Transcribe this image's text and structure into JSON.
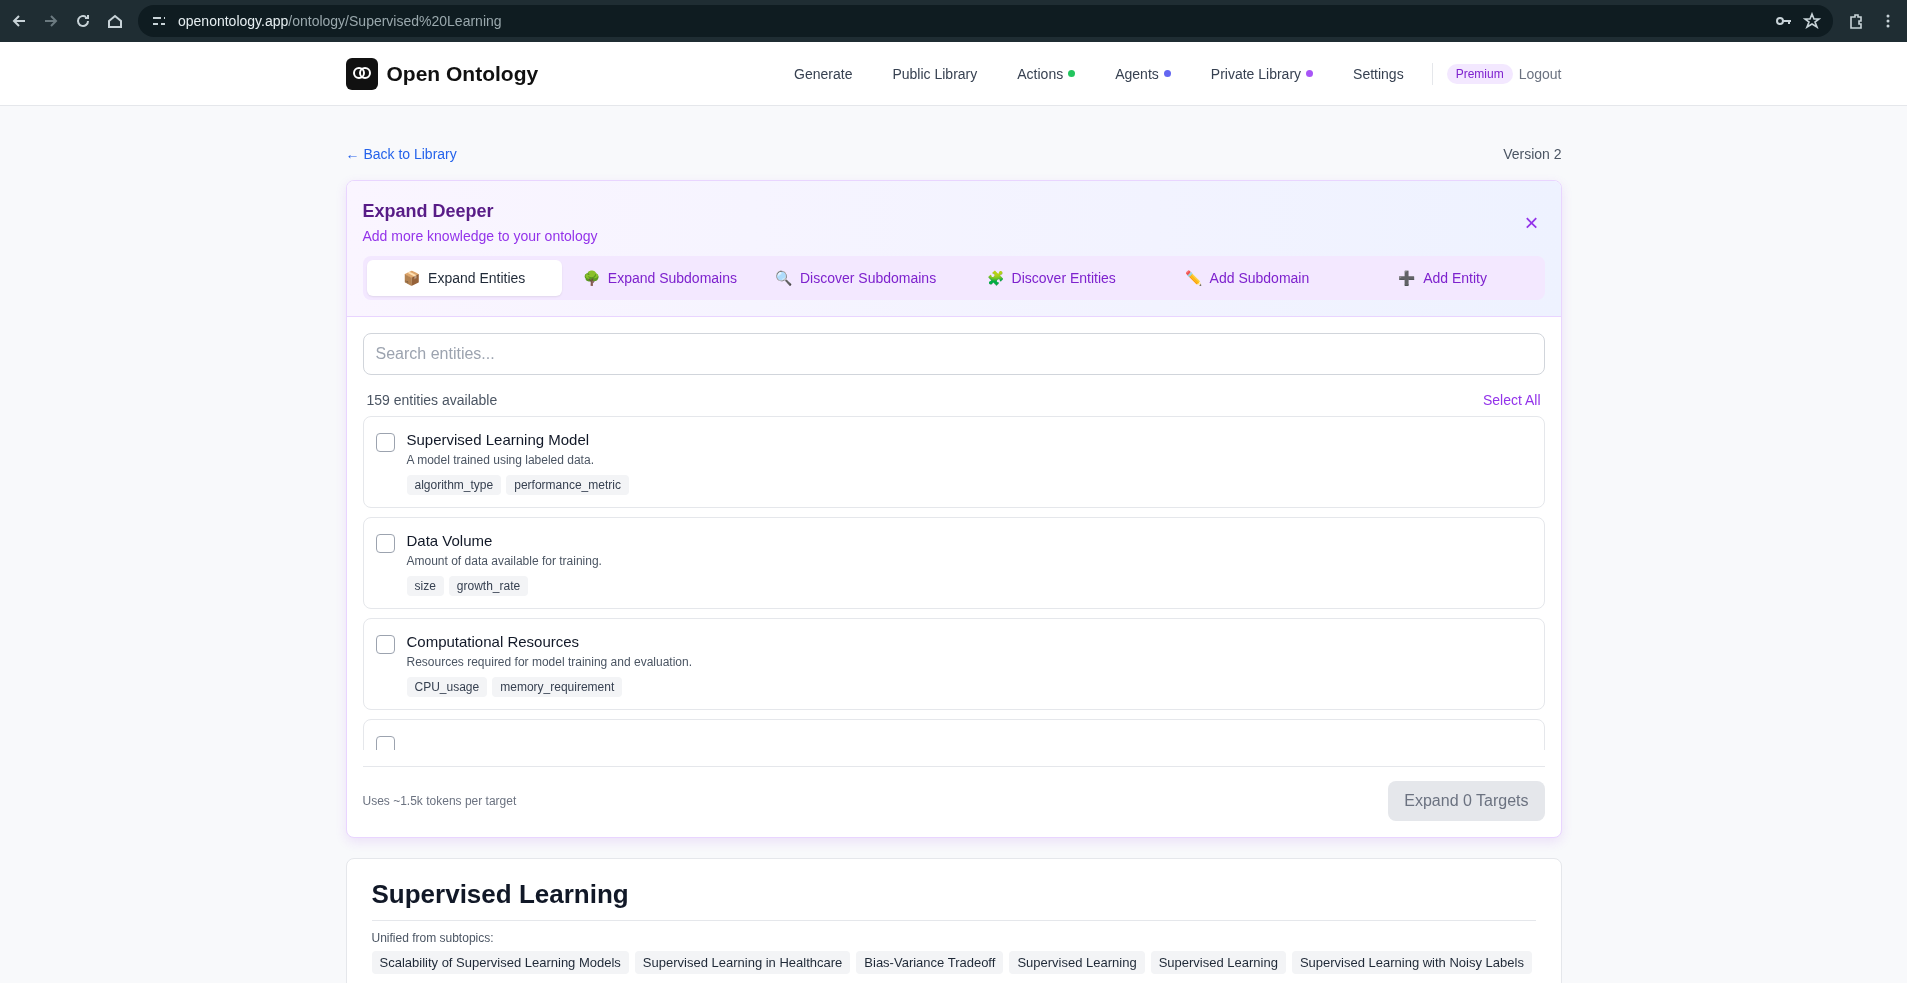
{
  "browser": {
    "url_host": "openontology.app",
    "url_path": "/ontology/Supervised%20Learning"
  },
  "header": {
    "brand": "Open Ontology",
    "nav": [
      {
        "label": "Generate"
      },
      {
        "label": "Public Library"
      },
      {
        "label": "Actions",
        "color": "#22c55e"
      },
      {
        "label": "Agents",
        "color": "#6366f1"
      },
      {
        "label": "Private Library",
        "color": "#a855f7"
      },
      {
        "label": "Settings"
      }
    ],
    "badge": "Premium",
    "logout": "Logout"
  },
  "back_link": "← Back to Library",
  "version": "Version 2",
  "expand_panel": {
    "title": "Expand Deeper",
    "subtitle": "Add more knowledge to your ontology",
    "close": "×",
    "tabs": [
      {
        "icon": "📦",
        "label": "Expand Entities",
        "selected": true
      },
      {
        "icon": "🌳",
        "label": "Expand Subdomains",
        "selected": false
      },
      {
        "icon": "🔍",
        "label": "Discover Subdomains",
        "selected": false
      },
      {
        "icon": "🧩",
        "label": "Discover Entities",
        "selected": false
      },
      {
        "icon": "✏️",
        "label": "Add Subdomain",
        "selected": false
      },
      {
        "icon": "➕",
        "label": "Add Entity",
        "selected": false
      }
    ],
    "search": {
      "placeholder": "Search entities..."
    },
    "count": "159 entities available",
    "select_all": "Select All",
    "entities": [
      {
        "name": "Supervised Learning Model",
        "description": "A model trained using labeled data.",
        "tags": [
          "algorithm_type",
          "performance_metric"
        ],
        "checked": false
      },
      {
        "name": "Data Volume",
        "description": "Amount of data available for training.",
        "tags": [
          "size",
          "growth_rate"
        ],
        "checked": false
      },
      {
        "name": "Computational Resources",
        "description": "Resources required for model training and evaluation.",
        "tags": [
          "CPU_usage",
          "memory_requirement"
        ],
        "checked": false
      },
      {
        "checked": false
      }
    ],
    "footer_note": "Uses ~1.5k tokens per target",
    "submit": {
      "label": "Expand 0 Targets",
      "disabled": true
    }
  },
  "ontology": {
    "title": "Supervised Learning",
    "unified_label": "Unified from subtopics:",
    "subtopics": [
      "Scalability of Supervised Learning Models",
      "Supervised Learning in Healthcare",
      "Bias-Variance Tradeoff",
      "Supervised Learning",
      "Supervised Learning",
      "Supervised Learning with Noisy Labels"
    ]
  }
}
